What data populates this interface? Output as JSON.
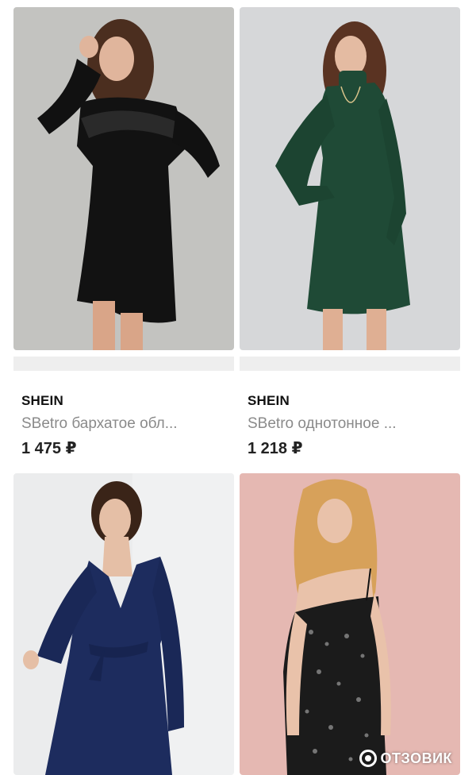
{
  "products": [
    {
      "brand": "SHEIN",
      "name": "SBetro бархатое обл...",
      "price": "1 475 ₽",
      "image": "black-velvet-ruffle-dress-photo",
      "colors": {
        "background": "#c7c6c4",
        "dress": "#121212"
      }
    },
    {
      "brand": "SHEIN",
      "name": "SBetro однотонное ...",
      "price": "1 218 ₽",
      "image": "green-turtleneck-dress-photo",
      "colors": {
        "background": "#d6d7d9",
        "dress": "#1f4a36"
      }
    },
    {
      "image": "navy-wrap-dress-photo",
      "colors": {
        "background": "#ebeced",
        "dress": "#1d2c5e"
      }
    },
    {
      "image": "black-sequin-slip-dress-photo",
      "colors": {
        "background": "#e5b8b2",
        "dress": "#1b1b1b"
      }
    }
  ],
  "watermark": {
    "text": "ОТЗОВИК",
    "icon": "otzovik-logo-icon"
  }
}
